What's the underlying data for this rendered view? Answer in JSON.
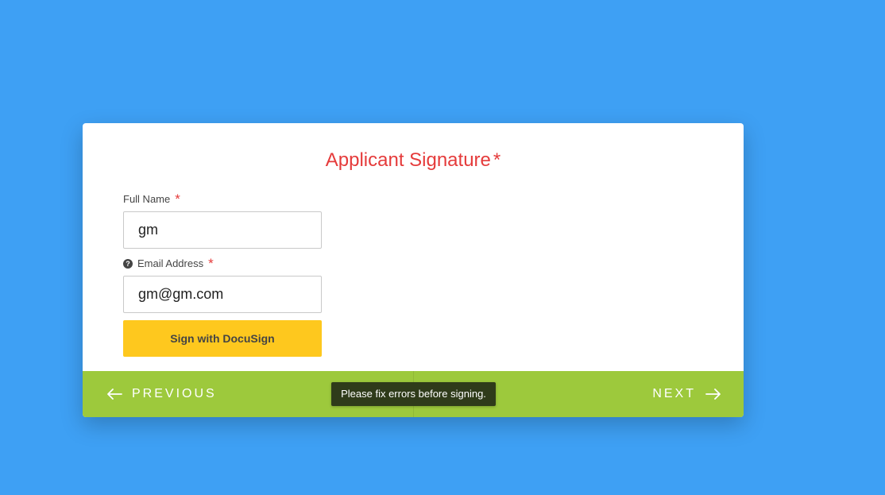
{
  "form": {
    "title": "Applicant Signature",
    "title_required_mark": "*",
    "full_name_label": "Full Name",
    "full_name_required_mark": "*",
    "full_name_value": "gm",
    "email_help_icon": "?",
    "email_label": "Email Address",
    "email_required_mark": "*",
    "email_value": "gm@gm.com",
    "sign_button_label": "Sign with DocuSign"
  },
  "footer": {
    "previous_label": "PREVIOUS",
    "next_label": "NEXT",
    "tooltip_text": "Please fix errors before signing."
  },
  "icons": {
    "previous": "arrow-left-icon",
    "next": "arrow-right-icon",
    "help": "question-circle-icon"
  },
  "colors": {
    "background": "#3ea0f4",
    "title": "#e53b3b",
    "sign_button": "#fec81e",
    "footer": "#9dc93c",
    "tooltip": "#2f3b1a"
  }
}
